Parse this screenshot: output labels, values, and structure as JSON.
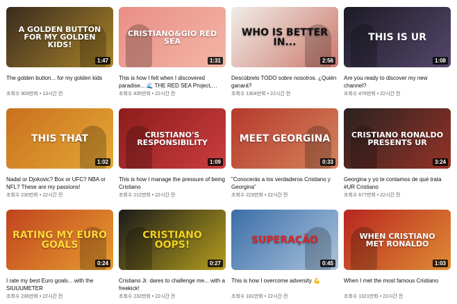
{
  "videos": [
    {
      "thumb_text": "A GOLDEN BUTTON FOR MY GOLDEN Kids!",
      "bg": "#3a2c1e",
      "accent": "#d4a52e",
      "text_color": "#ffffff",
      "duration": "1:47",
      "title": "The golden button... for my golden kids",
      "views": "조회수 903만회",
      "age": "13시간 전"
    },
    {
      "thumb_text": "CRISTIANO&GIO RED SEA",
      "bg": "#e98e86",
      "accent": "#f7c6b4",
      "text_color": "#ffffff",
      "duration": "1:31",
      "title": "This is how I felt when I discovered paradise... 🌊 THE RED SEA Project, Saudi",
      "views": "조회수 435만회",
      "age": "22시간 전"
    },
    {
      "thumb_text": "WHO IS BETTER IN...",
      "bg": "#f0ede8",
      "accent": "#c04a3a",
      "text_color": "#111111",
      "duration": "2:56",
      "title": "Descúbrelo TODO sobre nosotros. ¿Quién ganará?",
      "views": "조회수 1304만회",
      "age": "22시간 전"
    },
    {
      "thumb_text": "THIS IS UR",
      "bg": "#1c1a24",
      "accent": "#6b5a8a",
      "text_color": "#ffffff",
      "duration": "1:08",
      "title": "Are you ready to discover my new channel?",
      "views": "조회수 476만회",
      "age": "22시간 전"
    },
    {
      "thumb_text": "THIS THAT",
      "bg": "#c9701e",
      "accent": "#f0c040",
      "text_color": "#ffffff",
      "duration": "1:02",
      "title": "Nadal or Djokovic? Box or UFC? NBA or NFL? These are my passions!",
      "views": "조회수 230만회",
      "age": "22시간 전"
    },
    {
      "thumb_text": "CRISTIANO'S RESPONSIBILITY",
      "bg": "#8e1c1c",
      "accent": "#e24c4c",
      "text_color": "#ffffff",
      "duration": "1:09",
      "title": "This is how I manage the pressure of being Cristiano",
      "views": "조회수 212만회",
      "age": "22시간 전"
    },
    {
      "thumb_text": "MEET GEORGINA",
      "bg": "#b63a2c",
      "accent": "#e0a070",
      "text_color": "#ffffff",
      "duration": "0:33",
      "title": "\"Conocerás a los verdaderos Cristiano y Georgina\"",
      "views": "조회수 223만회",
      "age": "22시간 전"
    },
    {
      "thumb_text": "CRISTIANO RONALDO PRESENTS UR",
      "bg": "#2a2220",
      "accent": "#c0392b",
      "text_color": "#ffffff",
      "duration": "3:24",
      "title": "Georgina y yo te contamos de qué trata #UR Cristiano",
      "views": "조회수 677만회",
      "age": "22시간 전"
    },
    {
      "thumb_text": "RATING MY EURO GOALS",
      "bg": "#c1441f",
      "accent": "#f5c035",
      "text_color": "#ffd83a",
      "duration": "0:24",
      "title": "I rate my best Euro goals... with the SIUUUMETER",
      "views": "조회수 236만회",
      "age": "22시간 전"
    },
    {
      "thumb_text": "CRISTIANO OOPS!",
      "bg": "#1a1a1a",
      "accent": "#f2d21f",
      "text_color": "#f2d21f",
      "duration": "0:27",
      "title": "Cristiano Jr. dares to challenge me... with a freekick!",
      "views": "조회수 232만회",
      "age": "22시간 전"
    },
    {
      "thumb_text": "SUPERAÇÃO",
      "bg": "#3b6ea8",
      "accent": "#d8e6f2",
      "text_color": "#d62828",
      "duration": "0:45",
      "title": "This is how I overcome adversity 💪",
      "views": "조회수 181만회",
      "age": "22시간 전"
    },
    {
      "thumb_text": "WHEN CRISTIANO MET RONALDO",
      "bg": "#b7261f",
      "accent": "#f0b43c",
      "text_color": "#ffffff",
      "duration": "1:03",
      "title": "When I met the most famous Cristiano",
      "views": "조회수 1321만회",
      "age": "22시간 전"
    }
  ]
}
